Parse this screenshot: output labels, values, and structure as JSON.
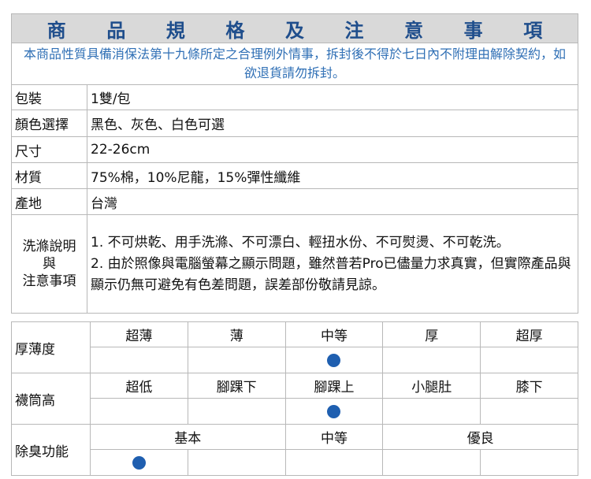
{
  "title": "商 品 規 格 及 注 意 事 項",
  "notice": "本商品性質具備消保法第十九條所定之合理例外情事，拆封後不得於七日內不附理由解除契約，如欲退貨請勿拆封。",
  "specs": [
    {
      "label": "包裝",
      "value": "1雙/包"
    },
    {
      "label": "顏色選擇",
      "value": "黑色、灰色、白色可選"
    },
    {
      "label": "尺寸",
      "value": "22-26cm"
    },
    {
      "label": "材質",
      "value": "75%棉，10%尼龍，15%彈性纖維"
    },
    {
      "label": "產地",
      "value": "台灣"
    }
  ],
  "care": {
    "label_line1": "洗滌說明",
    "label_line2": "與",
    "label_line3": "注意事項",
    "item1": "1. 不可烘乾、用手洗滌、不可漂白、輕扭水份、不可熨燙、不可乾洗。",
    "item2": "2. 由於照像與電腦螢幕之顯示問題，雖然普若Pro已儘量力求真實，但實際產品與 顯示仍無可避免有色差問題，誤差部份敬請見諒。"
  },
  "thickness": {
    "label": "厚薄度",
    "options": [
      "超薄",
      "薄",
      "中等",
      "厚",
      "超厚"
    ],
    "selected_index": 2
  },
  "sock_height": {
    "label": "襪筒高",
    "options": [
      "超低",
      "腳踝下",
      "腳踝上",
      "小腿肚",
      "膝下"
    ],
    "selected_index": 2
  },
  "deodorant": {
    "label": "除臭功能",
    "options": [
      "基本",
      "中等",
      "優良"
    ],
    "selected_index": 0
  },
  "colors": {
    "title_text": "#1f4e8c",
    "notice_text": "#2f6fb5",
    "mark": "#1f5fb0",
    "title_bg": "#d9d9d9",
    "border": "#b8b8b8"
  }
}
